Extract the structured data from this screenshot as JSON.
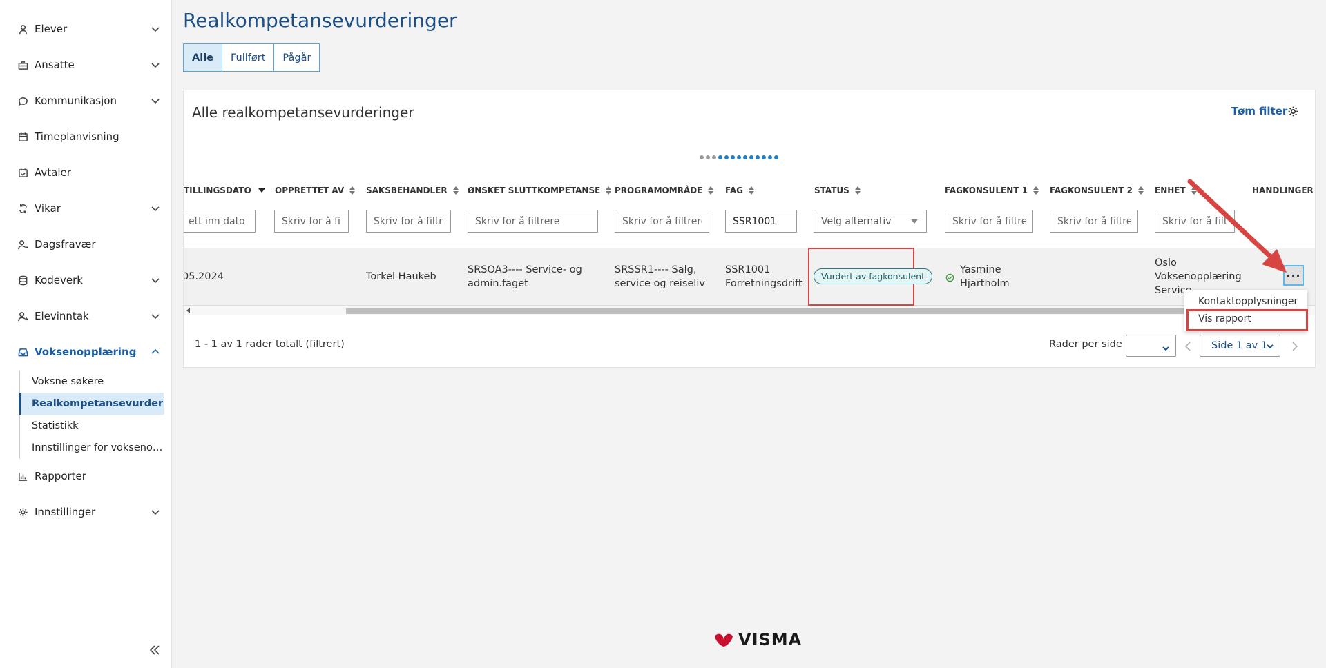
{
  "sidebar": {
    "items": [
      {
        "label": "Elever",
        "icon": "student-icon",
        "expandable": true
      },
      {
        "label": "Ansatte",
        "icon": "briefcase-icon",
        "expandable": true
      },
      {
        "label": "Kommunikasjon",
        "icon": "chat-icon",
        "expandable": true
      },
      {
        "label": "Timeplanvisning",
        "icon": "calendar-icon",
        "expandable": false
      },
      {
        "label": "Avtaler",
        "icon": "calendar-check-icon",
        "expandable": false
      },
      {
        "label": "Vikar",
        "icon": "swap-icon",
        "expandable": true
      },
      {
        "label": "Dagsfravær",
        "icon": "user-minus-icon",
        "expandable": false
      },
      {
        "label": "Kodeverk",
        "icon": "database-icon",
        "expandable": true
      },
      {
        "label": "Elevinntak",
        "icon": "user-plus-icon",
        "expandable": true
      },
      {
        "label": "Voksenopplæring",
        "icon": "inbox-icon",
        "expandable": true,
        "active": true
      },
      {
        "label": "Rapporter",
        "icon": "bar-chart-icon",
        "expandable": false
      },
      {
        "label": "Innstillinger",
        "icon": "gear-icon",
        "expandable": true
      }
    ],
    "subitems": [
      {
        "label": "Voksne søkere"
      },
      {
        "label": "Realkompetansevurder…",
        "selected": true
      },
      {
        "label": "Statistikk"
      },
      {
        "label": "Innstillinger for vokseno…"
      }
    ]
  },
  "page": {
    "title": "Realkompetansevurderinger",
    "tabs": [
      {
        "label": "Alle",
        "active": true
      },
      {
        "label": "Fullført"
      },
      {
        "label": "Pågår"
      }
    ]
  },
  "card": {
    "title": "Alle realkompetansevurderinger",
    "clear_filter": "Tøm filter"
  },
  "table": {
    "columns": [
      {
        "key": "date",
        "label": "TILLINGSDATO"
      },
      {
        "key": "created_by",
        "label": "OPPRETTET AV"
      },
      {
        "key": "case_handler",
        "label": "SAKSBEHANDLER"
      },
      {
        "key": "desired",
        "label": "ØNSKET SLUTTKOMPETANSE"
      },
      {
        "key": "program",
        "label": "PROGRAMOMRÅDE"
      },
      {
        "key": "subject",
        "label": "FAG"
      },
      {
        "key": "status",
        "label": "STATUS"
      },
      {
        "key": "consultant1",
        "label": "FAGKONSULENT 1"
      },
      {
        "key": "consultant2",
        "label": "FAGKONSULENT 2"
      },
      {
        "key": "unit",
        "label": "ENHET"
      },
      {
        "key": "actions",
        "label": "HANDLINGER"
      }
    ],
    "filters": {
      "date_placeholder": "ett inn dato",
      "created_by_placeholder": "Skriv for å filtrere",
      "case_handler_placeholder": "Skriv for å filtrere",
      "desired_placeholder": "Skriv for å filtrere",
      "program_placeholder": "Skriv for å filtrere",
      "subject_value": "SSR1001",
      "status_placeholder": "Velg alternativ",
      "consultant1_placeholder": "Skriv for å filtrere",
      "consultant2_placeholder": "Skriv for å filtrere",
      "unit_placeholder": "Skriv for å filtrere"
    },
    "row": {
      "date": "05.2024",
      "created_by": "",
      "case_handler": "Torkel Haukeb",
      "desired_1": "SRSOA3---- Service- og",
      "desired_2": "admin.faget",
      "program_1": "SRSSR1---- Salg,",
      "program_2": "service og reiseliv",
      "subject_1": "SSR1001",
      "subject_2": "Forretningsdrift",
      "status": "Vurdert av fagkonsulent",
      "consultant1_1": "Yasmine",
      "consultant1_2": "Hjartholm",
      "unit_1": "Oslo",
      "unit_2": "Voksenopplæring",
      "unit_3": "Service…",
      "actions_label": "···"
    }
  },
  "menu": {
    "items": [
      "Kontaktopplysninger",
      "Vis rapport"
    ]
  },
  "footer": {
    "info": "1 - 1 av 1 rader totalt (filtrert)",
    "rows_per_page": "Rader per side",
    "page_label": "Side 1 av 1"
  },
  "brand": {
    "name": "VISMA",
    "accent": "#1b4f86",
    "highlight": "#d64541",
    "logo_red": "#c8102e"
  }
}
